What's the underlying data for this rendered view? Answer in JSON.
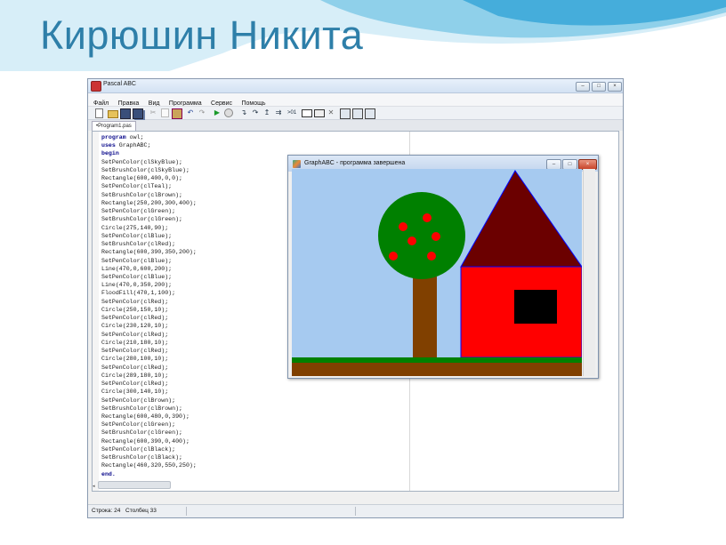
{
  "slide": {
    "title": "Кирюшин Никита"
  },
  "ide": {
    "window_title": "Pascal ABC",
    "window_buttons": {
      "minimize": "–",
      "maximize": "□",
      "close": "×"
    },
    "menu": [
      "Файл",
      "Правка",
      "Вид",
      "Программа",
      "Сервис",
      "Помощь"
    ],
    "toolbar_icons": [
      "new-file-icon",
      "open-icon",
      "save-icon",
      "save-all-icon",
      "cut-icon",
      "copy-icon",
      "paste-icon",
      "undo-icon",
      "redo-icon",
      "run-icon",
      "debug-icon",
      "step-into-icon",
      "step-over-icon",
      "step-out-icon",
      "breakpoint-icon",
      "output-window-icon",
      "form-icon",
      "stop-icon",
      "compile-icon",
      "compile-all-icon",
      "settings-icon"
    ],
    "tab_label": "•Program1.pas",
    "code_lines": [
      "program owl;",
      "uses GraphABC;",
      "begin",
      "SetPenColor(clSkyBlue);",
      "SetBrushColor(clSkyBlue);",
      "Rectangle(600,400,0,0);",
      "SetPenColor(clTeal);",
      "SetBrushColor(clBrown);",
      "Rectangle(250,200,300,400);",
      "SetPenColor(clGreen);",
      "SetBrushColor(clGreen);",
      "Circle(275,140,90);",
      "SetPenColor(clBlue);",
      "SetBrushColor(clRed);",
      "Rectangle(600,390,350,200);",
      "SetPenColor(clBlue);",
      "Line(470,0,600,200);",
      "SetPenColor(clBlue);",
      "Line(470,0,350,200);",
      "FloodFill(470,1,100);",
      "SetPenColor(clRed);",
      "Circle(250,150,10);",
      "SetPenColor(clRed);",
      "Circle(230,120,10);",
      "SetPenColor(clRed);",
      "Circle(210,180,10);",
      "SetPenColor(clRed);",
      "Circle(280,100,10);",
      "SetPenColor(clRed);",
      "Circle(289,180,10);",
      "SetPenColor(clRed);",
      "Circle(300,140,10);",
      "SetPenColor(clBrown);",
      "SetBrushColor(clBrown);",
      "Rectangle(600,480,0,390);",
      "SetPenColor(clGreen);",
      "SetBrushColor(clGreen);",
      "Rectangle(600,390,0,400);",
      "SetPenColor(clBlack);",
      "SetBrushColor(clBlack);",
      "Rectangle(460,320,550,250);",
      "end."
    ],
    "keywords": [
      "program",
      "uses",
      "begin",
      "end."
    ],
    "status": {
      "line_label": "Строка: 24",
      "column_label": "Столбец 33"
    }
  },
  "graph_window": {
    "title": "GraphABC - программа завершена",
    "colors": {
      "sky": "#a6caf0",
      "trunk": "#804000",
      "foliage": "#008000",
      "fruit": "#ff0000",
      "roof": "#6b0000",
      "wall": "#ff0000",
      "outline": "#0000ff",
      "window": "#000000",
      "ground": "#804000",
      "grass": "#008000"
    }
  },
  "colors": {
    "title_text": "#2e7fa9",
    "wave_light": "#cde8f4",
    "wave_mid": "#7cc4e2",
    "wave_dark": "#3aa3d2"
  }
}
